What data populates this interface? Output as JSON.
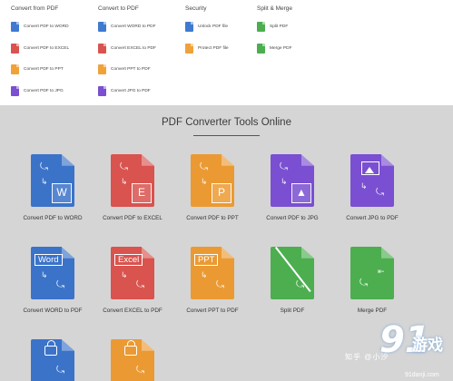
{
  "menu": {
    "columns": [
      {
        "heading": "Convert from PDF",
        "items": [
          {
            "label": "Convert PDF to WORD",
            "color": "#3f7ad1"
          },
          {
            "label": "Convert PDF to EXCEL",
            "color": "#d9534f"
          },
          {
            "label": "Convert PDF to PPT",
            "color": "#f0a239"
          },
          {
            "label": "Convert PDF to JPG",
            "color": "#7a4fd1"
          }
        ]
      },
      {
        "heading": "Convert to PDF",
        "items": [
          {
            "label": "Convert WORD to PDF",
            "color": "#3f7ad1"
          },
          {
            "label": "Convert EXCEL to PDF",
            "color": "#d9534f"
          },
          {
            "label": "Convert PPT to PDF",
            "color": "#f0a239"
          },
          {
            "label": "Convert JPG to PDF",
            "color": "#7a4fd1"
          }
        ]
      },
      {
        "heading": "Security",
        "items": [
          {
            "label": "Unlock PDF file",
            "color": "#3f7ad1"
          },
          {
            "label": "Protect PDF file",
            "color": "#f0a239"
          }
        ]
      },
      {
        "heading": "Split & Merge",
        "items": [
          {
            "label": "Split PDF",
            "color": "#4cae4f"
          },
          {
            "label": "Merge PDF",
            "color": "#4cae4f"
          }
        ]
      }
    ]
  },
  "section": {
    "title": "PDF Converter Tools Online"
  },
  "tools": [
    {
      "label": "Convert PDF to WORD",
      "color": "#3b73c9",
      "tag": "W",
      "icon": "pdf-to-word-icon"
    },
    {
      "label": "Convert PDF to EXCEL",
      "color": "#d9534f",
      "tag": "E",
      "icon": "pdf-to-excel-icon"
    },
    {
      "label": "Convert PDF to PPT",
      "color": "#eb9a33",
      "tag": "P",
      "icon": "pdf-to-ppt-icon"
    },
    {
      "label": "Convert PDF to JPG",
      "color": "#7a4fd1",
      "tag": "",
      "icon": "pdf-to-jpg-icon"
    },
    {
      "label": "Convert JPG to PDF",
      "color": "#7a4fd1",
      "tag": "",
      "icon": "jpg-to-pdf-icon"
    },
    {
      "label": "Convert WORD to PDF",
      "color": "#3b73c9",
      "word": "Word",
      "icon": "word-to-pdf-icon"
    },
    {
      "label": "Convert EXCEL to PDF",
      "color": "#d9534f",
      "word": "Excel",
      "icon": "excel-to-pdf-icon"
    },
    {
      "label": "Convert PPT to PDF",
      "color": "#eb9a33",
      "word": "PPT",
      "icon": "ppt-to-pdf-icon"
    },
    {
      "label": "Split PDF",
      "color": "#4cae4f",
      "icon": "split-pdf-icon"
    },
    {
      "label": "Merge PDF",
      "color": "#4cae4f",
      "icon": "merge-pdf-icon"
    },
    {
      "label": "",
      "color": "#3b73c9",
      "icon": "unlock-pdf-icon"
    },
    {
      "label": "",
      "color": "#eb9a33",
      "icon": "protect-pdf-icon"
    }
  ],
  "watermark": {
    "zhihu": "知乎 @小汐",
    "logo_num": "91",
    "logo_cn": "游戏",
    "url": "91danji.com"
  }
}
